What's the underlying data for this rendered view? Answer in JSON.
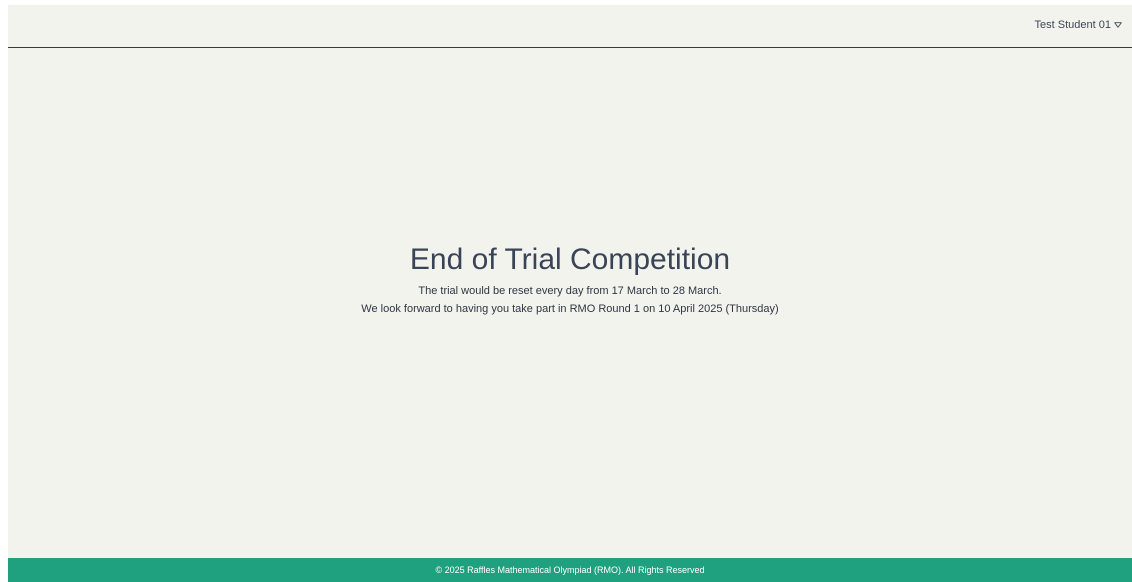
{
  "header": {
    "user_name": "Test Student 01",
    "dropdown_icon": "chevron-down-icon"
  },
  "main": {
    "title": "End of Trial Competition",
    "line1": "The trial would be reset every day from 17 March to 28 March.",
    "line2": "We look forward to having you take part in RMO Round 1 on 10 April 2025 (Thursday)"
  },
  "footer": {
    "copyright": "© 2025 Raffles Mathematical Olympiad (RMO). All Rights Reserved"
  },
  "colors": {
    "background": "#f3f3ee",
    "footer": "#1fa07f",
    "title_text": "#394456"
  }
}
